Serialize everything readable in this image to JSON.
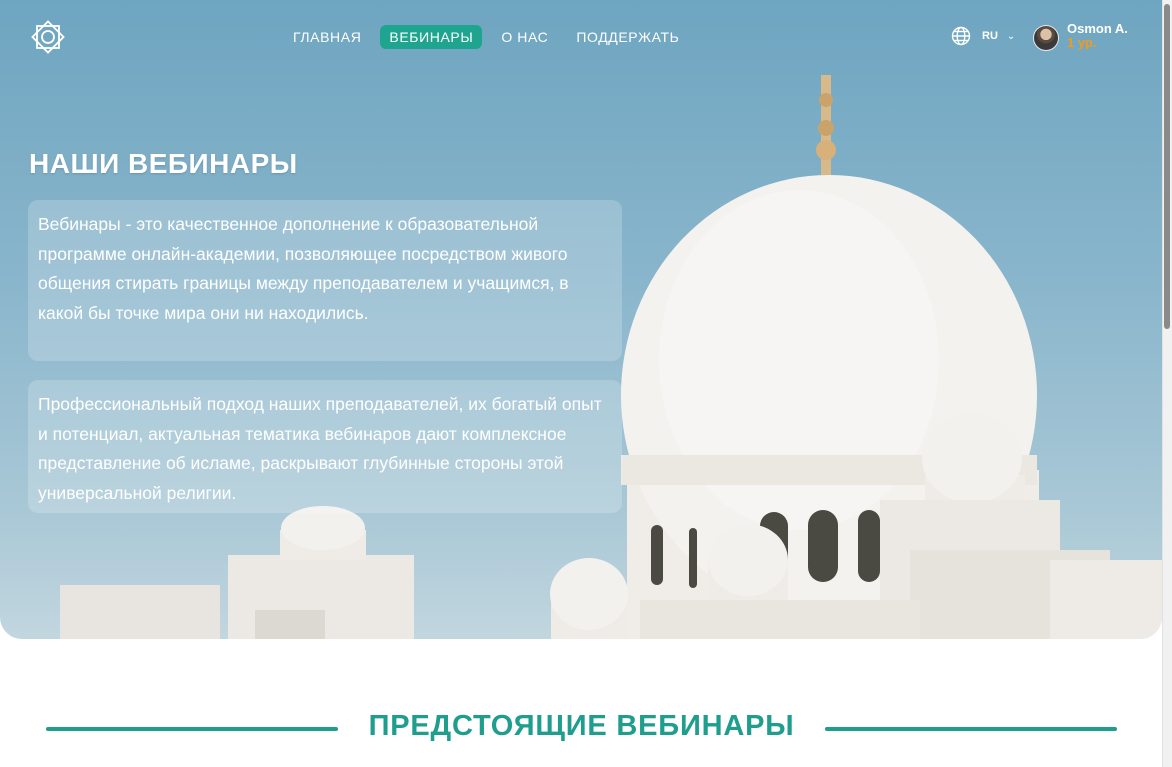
{
  "header": {
    "logo_icon": "star-ornament-icon",
    "nav": [
      {
        "label": "ГЛАВНАЯ",
        "active": false
      },
      {
        "label": "ВЕБИНАРЫ",
        "active": true
      },
      {
        "label": "О НАС",
        "active": false
      },
      {
        "label": "ПОДДЕРЖАТЬ",
        "active": false
      }
    ],
    "language": {
      "icon": "globe-icon",
      "code": "RU",
      "dropdown_icon": "chevron-down-icon"
    },
    "user": {
      "name": "Osmon A.",
      "level": "1 ур."
    }
  },
  "hero": {
    "title": "НАШИ ВЕБИНАРЫ",
    "paragraph_1": "Вебинары - это качественное дополнение к образовательной программе онлайн-академии, позволяющее посредством живого общения стирать границы между преподавателем и учащимся, в какой бы точке мира они ни находились.",
    "paragraph_2": "Профессиональный подход наших преподавателей, их богатый опыт и потенциал, актуальная тематика вебинаров дают комплексное представление об исламе, раскрывают глубинные стороны этой универсальной религии."
  },
  "upcoming": {
    "title": "ПРЕДСТОЯЩИЕ ВЕБИНАРЫ"
  },
  "colors": {
    "accent": "#1fa58f",
    "heading": "#1f9d8d",
    "level": "#f29a1f"
  }
}
